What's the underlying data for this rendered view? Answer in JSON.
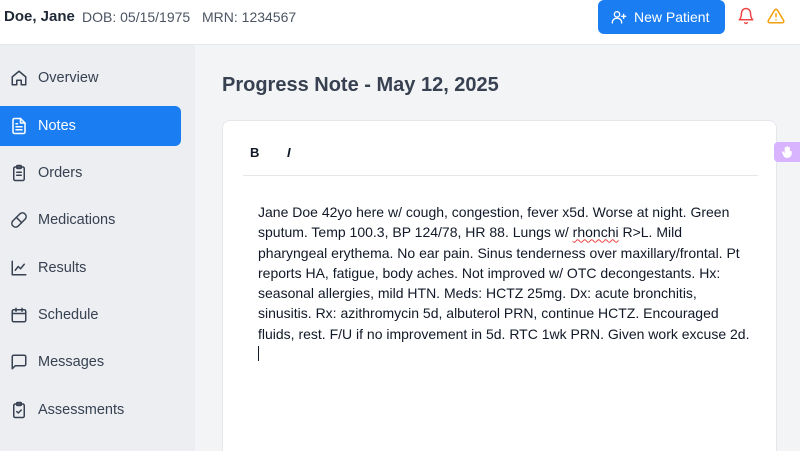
{
  "header": {
    "patient_name": "Doe, Jane",
    "dob": "DOB: 05/15/1975",
    "mrn": "MRN: 1234567",
    "new_patient_label": "New Patient",
    "accent": "#1a7ef2",
    "icons": [
      "user-plus-icon",
      "bell-icon",
      "warning-icon"
    ]
  },
  "sidebar": {
    "items": [
      {
        "label": "Overview",
        "icon": "home-icon",
        "active": false
      },
      {
        "label": "Notes",
        "icon": "document-icon",
        "active": true
      },
      {
        "label": "Orders",
        "icon": "clipboard-icon",
        "active": false
      },
      {
        "label": "Medications",
        "icon": "pill-icon",
        "active": false
      },
      {
        "label": "Results",
        "icon": "line-chart-icon",
        "active": false
      },
      {
        "label": "Schedule",
        "icon": "calendar-icon",
        "active": false
      },
      {
        "label": "Messages",
        "icon": "message-icon",
        "active": false
      },
      {
        "label": "Assessments",
        "icon": "clipboard-check-icon",
        "active": false
      }
    ]
  },
  "main": {
    "title": "Progress Note - May 12, 2025",
    "toolbar": {
      "bold": "B",
      "italic": "I"
    },
    "note": {
      "before": "Jane Doe 42yo here w/ cough, congestion, fever x5d. Worse at night. Green sputum. Temp 100.3, BP 124/78, HR 88. Lungs w/ ",
      "flagged": "rhonchi",
      "after": " R>L. Mild pharyngeal erythema. No ear pain. Sinus tenderness over maxillary/frontal. Pt reports HA, fatigue, body aches. Not improved w/ OTC decongestants. Hx: seasonal allergies, mild HTN. Meds: HCTZ 25mg. Dx: acute bronchitis, sinusitis. Rx: azithromycin 5d, albuterol PRN, continue HCTZ. Encouraged fluids, rest. F/U if no improvement in 5d. RTC 1wk PRN. Given work excuse 2d."
    }
  },
  "side_tab": {
    "icon": "hand-icon",
    "color": "#d8b4fe"
  }
}
